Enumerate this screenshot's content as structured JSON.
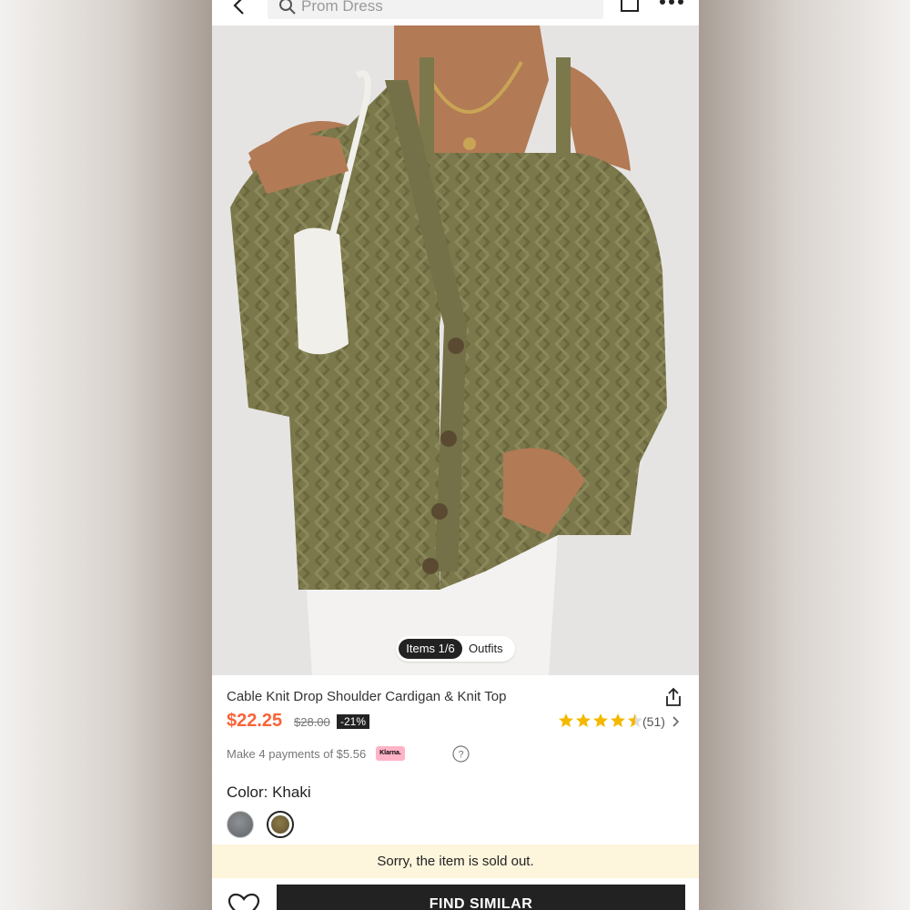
{
  "search": {
    "placeholder": "Prom Dress"
  },
  "gallery": {
    "items_label": "Items 1/6",
    "outfits_label": "Outfits"
  },
  "product": {
    "title": "Cable Knit Drop Shoulder Cardigan & Knit Top",
    "price": "$22.25",
    "original_price": "$28.00",
    "discount": "-21%",
    "rating": 4.5,
    "review_count": "(51)",
    "installments": "Make 4 payments of $5.56",
    "klarna_label": "Klarna."
  },
  "color": {
    "label": "Color: Khaki",
    "options": [
      "gray",
      "khaki"
    ],
    "selected": "khaki"
  },
  "status": {
    "sold_out": "Sorry, the item is sold out."
  },
  "actions": {
    "find_similar": "FIND SIMILAR"
  },
  "colors": {
    "price": "#fa6338",
    "star": "#f5b800",
    "soldout_bg": "#fdf5dc",
    "sweater": "#7d7a4e",
    "klarna": "#ffb3c7"
  }
}
